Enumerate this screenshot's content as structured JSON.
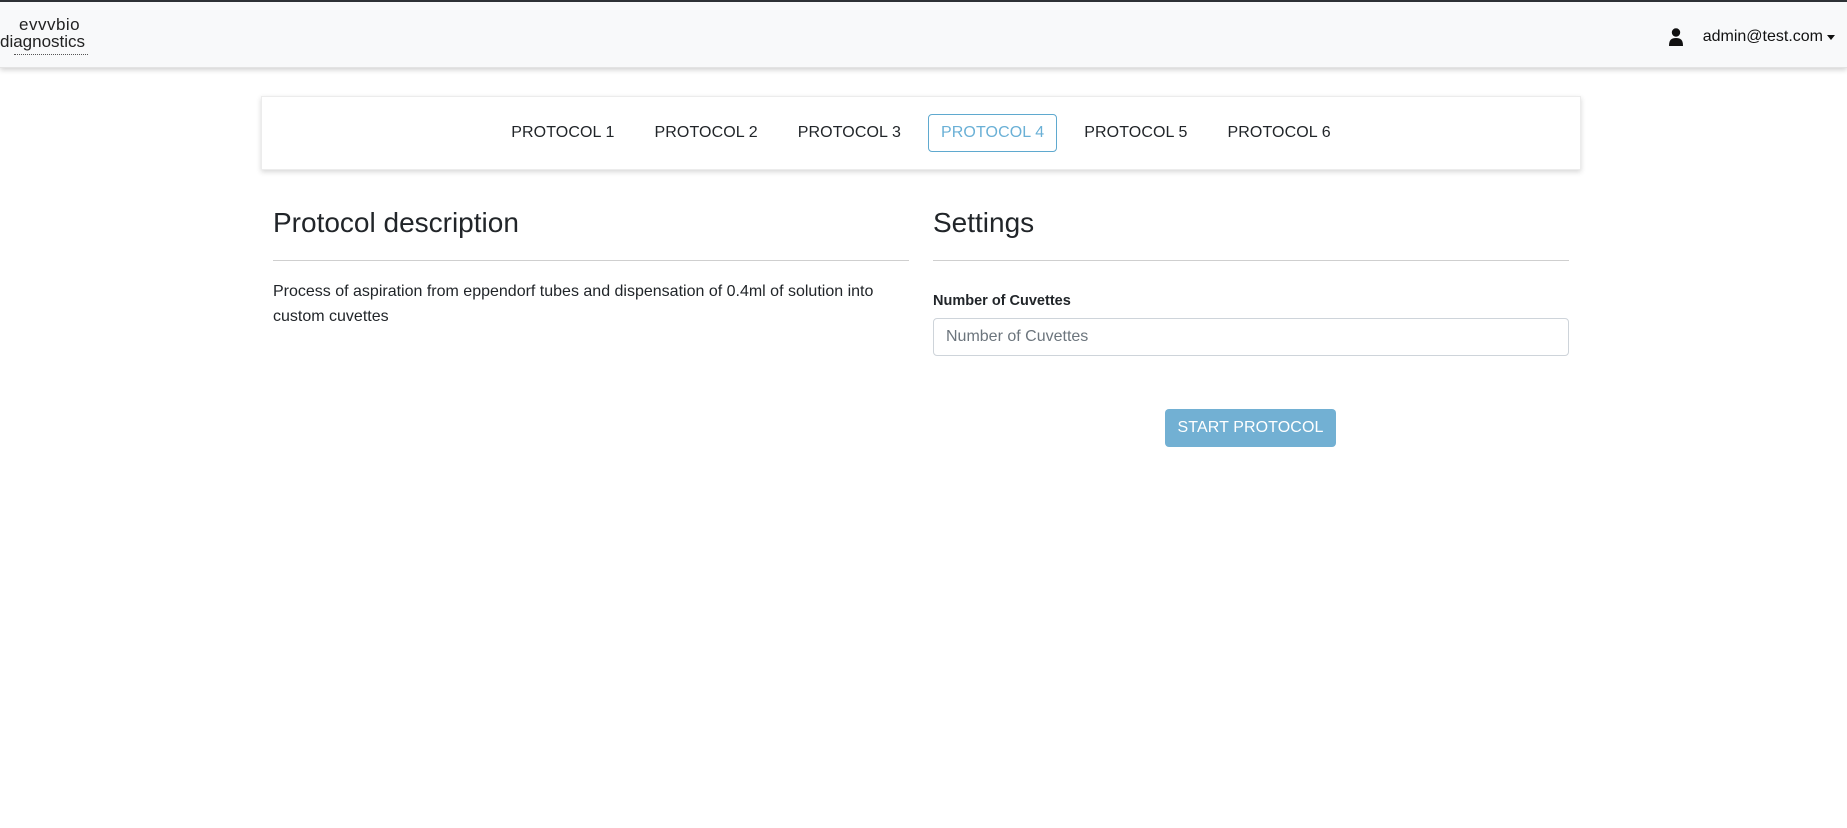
{
  "brand": {
    "logo_line1": "evvvbio",
    "logo_line2": "diagnostics"
  },
  "header": {
    "user_icon": "user-icon",
    "user_email": "admin@test.com"
  },
  "tabs": [
    {
      "label": "PROTOCOL 1",
      "active": false
    },
    {
      "label": "PROTOCOL 2",
      "active": false
    },
    {
      "label": "PROTOCOL 3",
      "active": false
    },
    {
      "label": "PROTOCOL 4",
      "active": true
    },
    {
      "label": "PROTOCOL 5",
      "active": false
    },
    {
      "label": "PROTOCOL 6",
      "active": false
    }
  ],
  "description": {
    "title": "Protocol description",
    "text": "Process of aspiration from eppendorf tubes and dispensation of 0.4ml of solution into custom cuvettes"
  },
  "settings": {
    "title": "Settings",
    "cuvettes_label": "Number of Cuvettes",
    "cuvettes_placeholder": "Number of Cuvettes",
    "cuvettes_value": ""
  },
  "actions": {
    "start_label": "START PROTOCOL"
  },
  "colors": {
    "accent": "#6ab0d6",
    "button_bg": "#72b0d3",
    "navbar_bg": "#f8f9fa"
  }
}
